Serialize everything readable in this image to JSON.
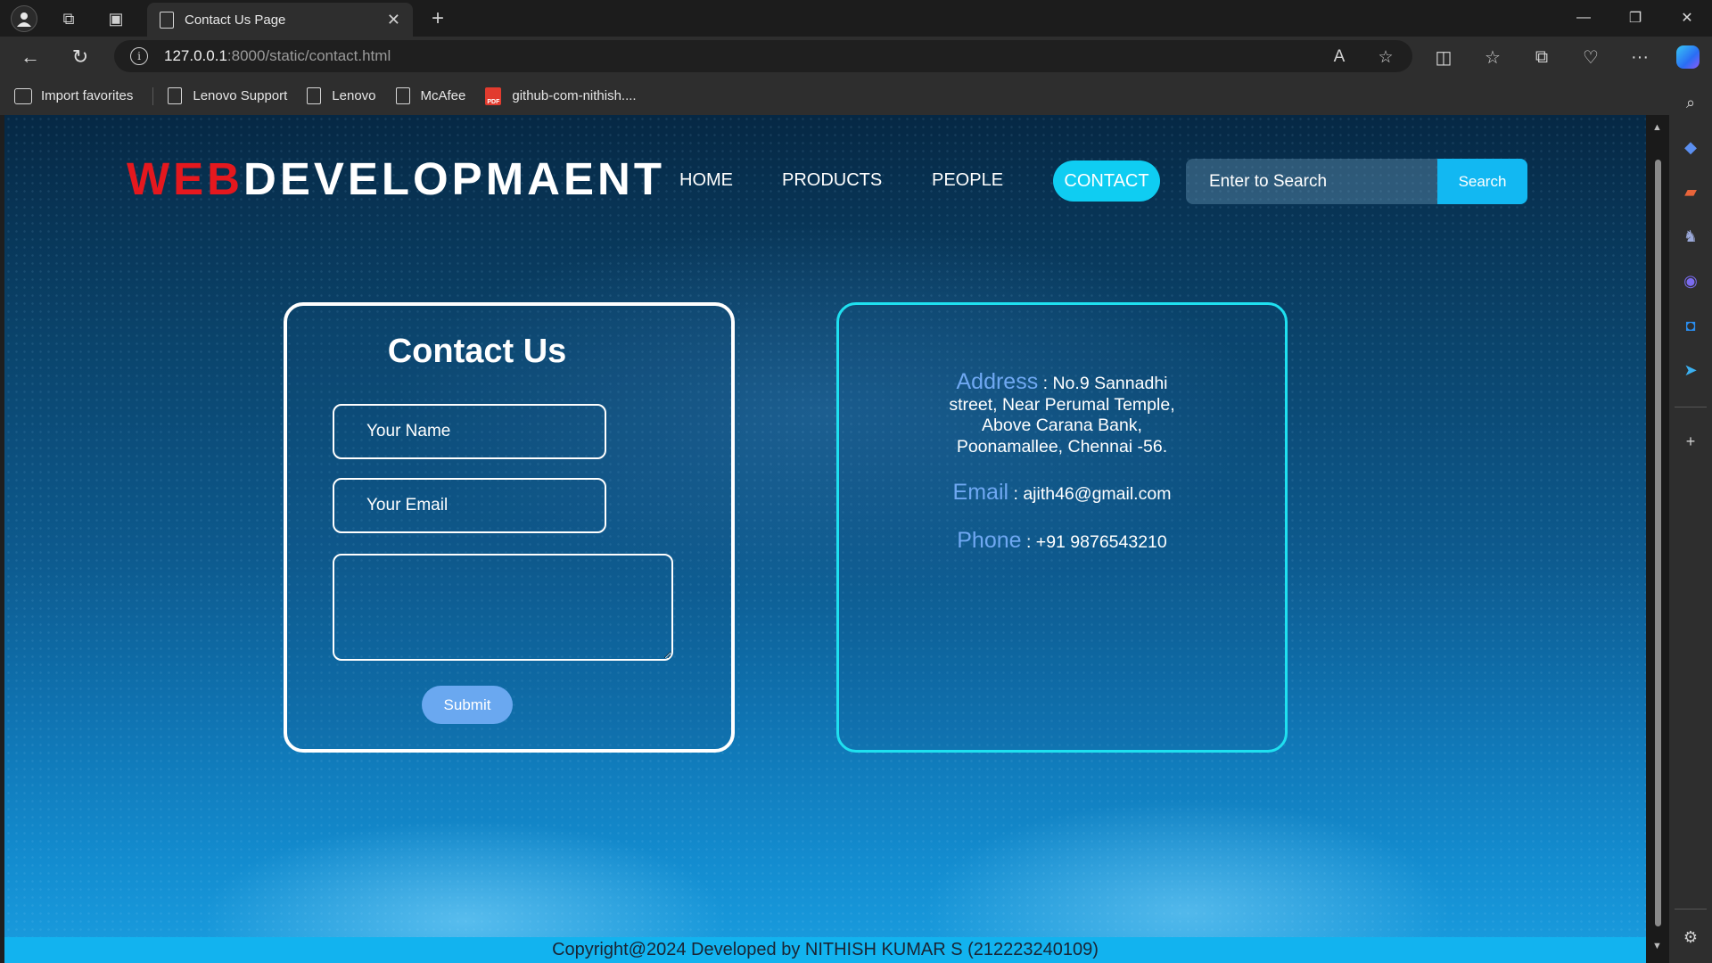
{
  "browser": {
    "tab_title": "Contact Us Page",
    "tab_close": "✕",
    "new_tab": "+",
    "url_host": "127.0.0.1",
    "url_path": ":8000/static/contact.html",
    "read_aloud": "A",
    "more_menu": "···",
    "icons": [
      "profile-icon",
      "workspaces-icon",
      "tab-actions-icon",
      "back-icon",
      "refresh-icon",
      "site-info-icon",
      "read-aloud-icon",
      "favorite-star-icon",
      "split-screen-icon",
      "favorites-icon",
      "collections-icon",
      "browser-essentials-icon",
      "more-icon",
      "copilot-icon"
    ]
  },
  "window_controls": {
    "minimize": "—",
    "maximize": "❐",
    "close": "✕"
  },
  "bookmarks": [
    {
      "label": "Import favorites",
      "icon": "import-icon"
    },
    {
      "label": "Lenovo Support",
      "icon": "page-icon"
    },
    {
      "label": "Lenovo",
      "icon": "page-icon"
    },
    {
      "label": "McAfee",
      "icon": "page-icon"
    },
    {
      "label": "github-com-nithish....",
      "icon": "pdf-icon"
    }
  ],
  "sidebar_icons": [
    "search-icon",
    "shopping-tag-icon",
    "tools-icon",
    "games-icon",
    "copilot-app-icon",
    "outlook-icon",
    "telegram-icon",
    "add-icon",
    "settings-icon"
  ],
  "page": {
    "logo_red": "WEB",
    "logo_white": "DEVELOPMAENT",
    "nav": {
      "home": "HOME",
      "products": "PRODUCTS",
      "people": "PEOPLE",
      "contact": "CONTACT"
    },
    "search": {
      "placeholder": "Enter to Search",
      "button": "Search"
    },
    "form": {
      "title": "Contact Us",
      "name_placeholder": "Your Name",
      "email_placeholder": "Your Email",
      "message_value": "",
      "submit": "Submit"
    },
    "info": {
      "address_label": "Address",
      "address_value": ": No.9 Sannadhi street, Near Perumal Temple, Above Carana Bank, Poonamallee, Chennai -56.",
      "email_label": "Email",
      "email_value": ": ajith46@gmail.com",
      "phone_label": "Phone",
      "phone_value": ": +91 9876543210"
    },
    "footer": "Copyright@2024 Developed by NITHISH KUMAR S (212223240109)"
  },
  "colors": {
    "accent": "#0fcdf2",
    "logo_red": "#e5181e",
    "label_blue": "#6fa8f2",
    "info_border": "#1fe0f0",
    "submit": "#6aa8f0"
  }
}
